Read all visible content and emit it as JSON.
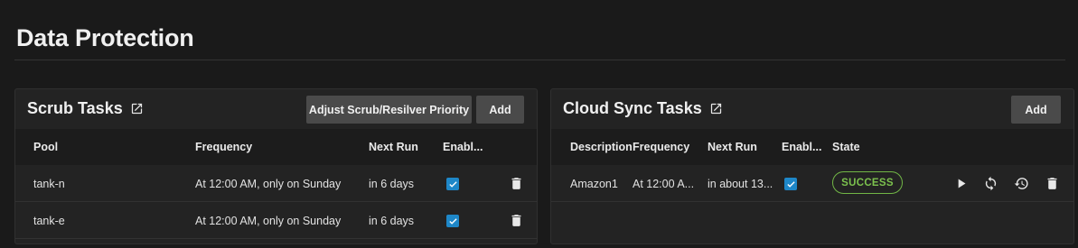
{
  "page": {
    "title": "Data Protection"
  },
  "scrub_tasks": {
    "title": "Scrub Tasks",
    "adjust_label": "Adjust Scrub/Resilver Priority",
    "add_label": "Add",
    "columns": [
      "Pool",
      "Frequency",
      "Next Run",
      "Enabl..."
    ],
    "rows": [
      {
        "pool": "tank-n",
        "frequency": "At 12:00 AM, only on Sunday",
        "next_run": "in 6 days",
        "enabled": true
      },
      {
        "pool": "tank-e",
        "frequency": "At 12:00 AM, only on Sunday",
        "next_run": "in 6 days",
        "enabled": true
      }
    ]
  },
  "cloud_sync": {
    "title": "Cloud Sync Tasks",
    "add_label": "Add",
    "columns": [
      "Description",
      "Frequency",
      "Next Run",
      "Enabl...",
      "State"
    ],
    "rows": [
      {
        "description": "Amazon1",
        "frequency": "At 12:00 A...",
        "next_run": "in about 13...",
        "enabled": true,
        "state": "SUCCESS"
      }
    ]
  },
  "icons": {
    "open_in_new": "open-in-new-icon",
    "delete": "trash-icon",
    "run": "play-icon",
    "sync": "sync-icon",
    "restore": "restore-icon",
    "check": "check-icon"
  },
  "colors": {
    "background": "#1a1a1a",
    "card": "#232323",
    "button": "#4a4a4a",
    "checkbox": "#1e87c8",
    "success": "#7cc24e"
  }
}
